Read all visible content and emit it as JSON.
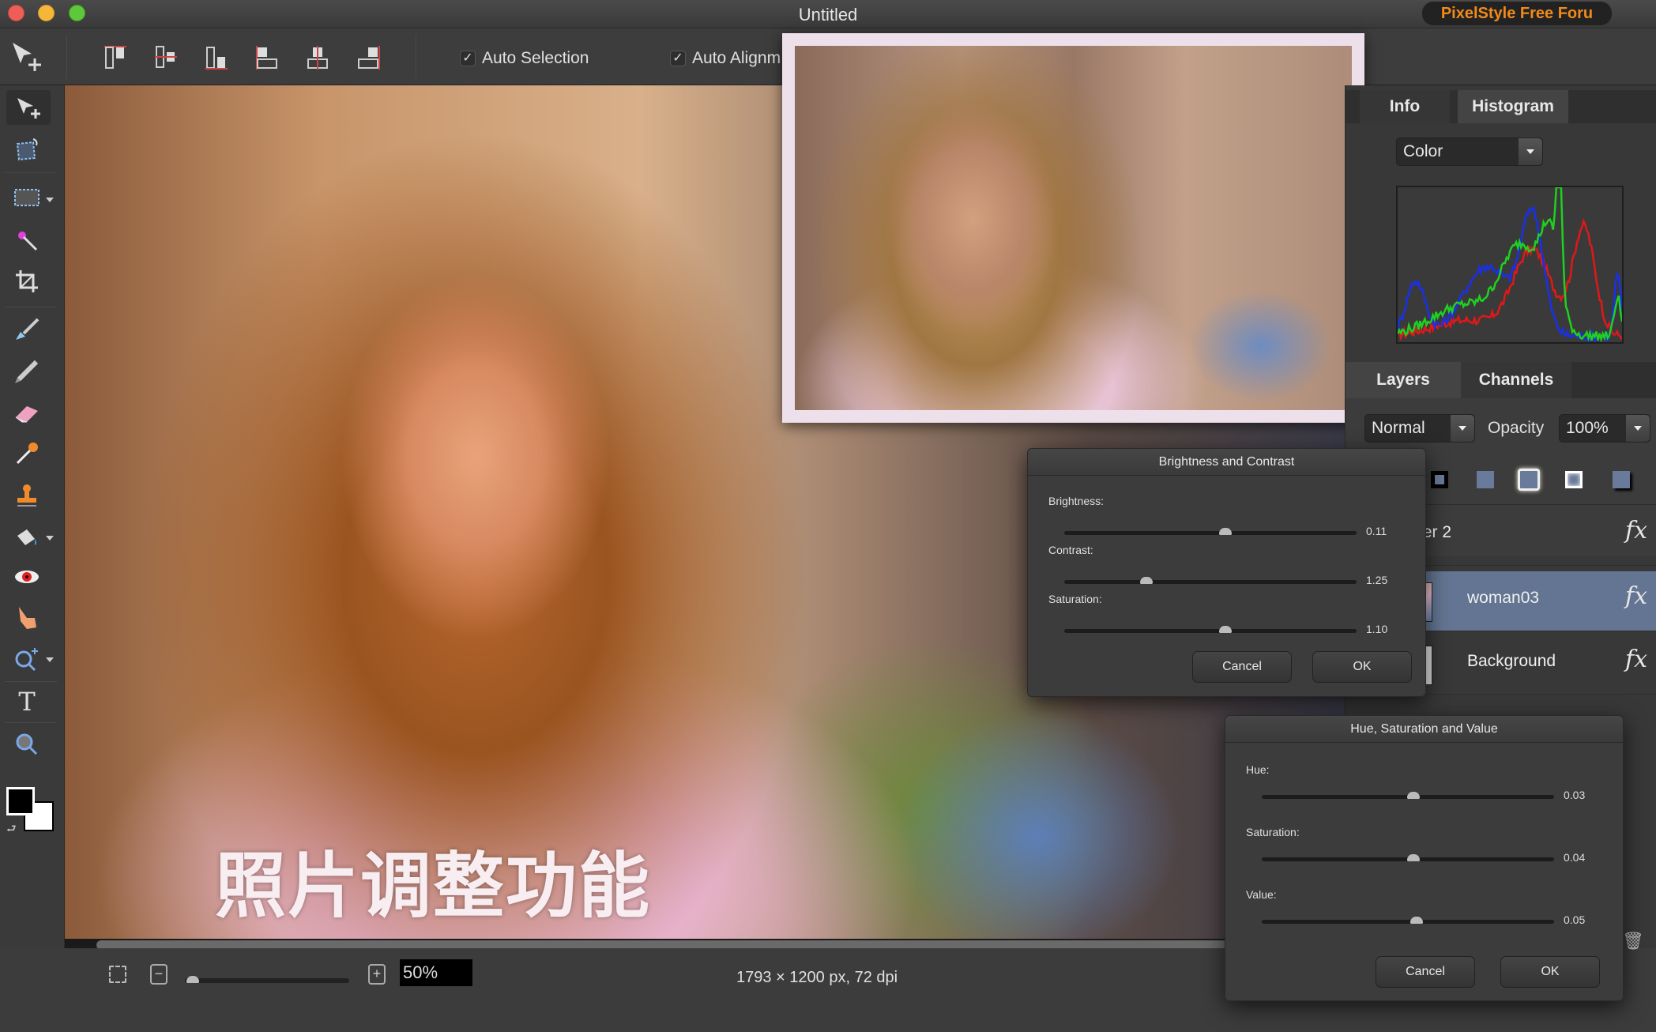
{
  "window": {
    "title": "Untitled",
    "promo_badge": "PixelStyle Free Foru"
  },
  "toolbar": {
    "move_tool": "move-tool",
    "align_buttons": [
      "align-top",
      "align-vertical-center",
      "align-bottom",
      "align-left",
      "align-horizontal-center",
      "align-right"
    ],
    "auto_selection": {
      "label": "Auto Selection",
      "checked": true
    },
    "auto_align": {
      "label": "Auto Alignm",
      "checked": true
    }
  },
  "tools": [
    {
      "name": "move-tool",
      "icon": "move-arrow-icon"
    },
    {
      "name": "transform-tool",
      "icon": "transform-icon"
    },
    {
      "name": "marquee-tool",
      "icon": "rect-marquee-icon",
      "has_menu": true
    },
    {
      "name": "magic-wand-tool",
      "icon": "magic-wand-icon"
    },
    {
      "name": "crop-tool",
      "icon": "crop-icon"
    },
    {
      "name": "brush-tool",
      "icon": "brush-icon"
    },
    {
      "name": "pencil-tool",
      "icon": "pencil-icon"
    },
    {
      "name": "eraser-tool",
      "icon": "eraser-icon"
    },
    {
      "name": "eyedropper-tool",
      "icon": "eyedropper-icon"
    },
    {
      "name": "stamp-tool",
      "icon": "stamp-icon"
    },
    {
      "name": "fill-tool",
      "icon": "paint-bucket-icon",
      "has_menu": true
    },
    {
      "name": "red-eye-tool",
      "icon": "eye-icon"
    },
    {
      "name": "smudge-tool",
      "icon": "finger-icon"
    },
    {
      "name": "zoom-tool",
      "icon": "zoom-in-icon",
      "has_menu": true
    },
    {
      "name": "text-tool",
      "icon": "text-icon",
      "glyph": "T"
    },
    {
      "name": "view-tool",
      "icon": "magnifier-icon"
    }
  ],
  "colors": {
    "foreground": "#000000",
    "background": "#ffffff",
    "accent_selected_layer": "#637592",
    "promo_text": "#f08a1c"
  },
  "canvas": {
    "overlay_text": "照片调整功能"
  },
  "statusbar": {
    "zoom_value": "50%",
    "zoom_fraction": 0.05,
    "doc_info": "1793 × 1200 px, 72 dpi"
  },
  "right_panel": {
    "top_tabs": [
      {
        "label": "Info",
        "active": false
      },
      {
        "label": "Histogram",
        "active": true
      }
    ],
    "histogram_mode": "Color",
    "layer_tabs": [
      {
        "label": "Layers",
        "active": true
      },
      {
        "label": "Channels",
        "active": false
      }
    ],
    "blend_mode": "Normal",
    "opacity_label": "Opacity",
    "opacity_value": "100%",
    "layer_styles": [
      "shadow-style",
      "flat-style",
      "outer-glow-style",
      "inner-glow-style",
      "drop-shadow-style"
    ],
    "layers": [
      {
        "name": "Layer 2",
        "selected": false,
        "fx": "fx"
      },
      {
        "name": "woman03",
        "selected": true,
        "fx": "fx"
      },
      {
        "name": "Background",
        "selected": false,
        "fx": "fx"
      }
    ]
  },
  "dialogs": {
    "brightness_contrast": {
      "title": "Brightness and Contrast",
      "sliders": [
        {
          "label": "Brightness:",
          "value": "0.11",
          "position": 0.55
        },
        {
          "label": "Contrast:",
          "value": "1.25",
          "position": 0.28
        },
        {
          "label": "Saturation:",
          "value": "1.10",
          "position": 0.55
        }
      ],
      "cancel": "Cancel",
      "ok": "OK"
    },
    "hue_saturation_value": {
      "title": "Hue, Saturation and Value",
      "sliders": [
        {
          "label": "Hue:",
          "value": "0.03",
          "position": 0.52
        },
        {
          "label": "Saturation:",
          "value": "0.04",
          "position": 0.52
        },
        {
          "label": "Value:",
          "value": "0.05",
          "position": 0.53
        }
      ],
      "cancel": "Cancel",
      "ok": "OK"
    }
  }
}
